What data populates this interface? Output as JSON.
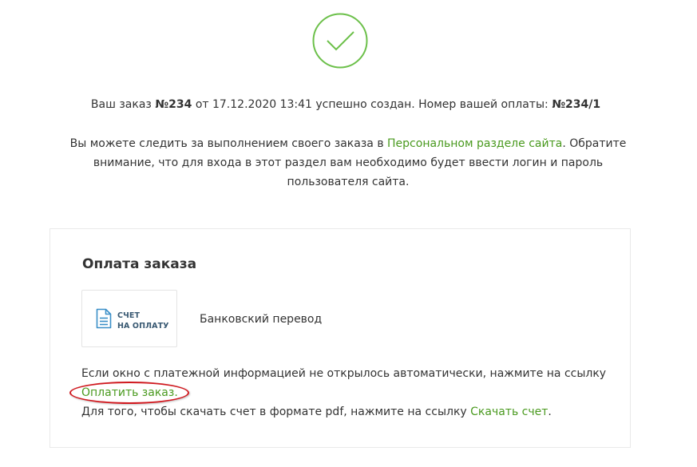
{
  "status": {
    "icon": "checkmark-circle-icon",
    "color": "#6cc04a"
  },
  "order": {
    "prefix": "Ваш заказ ",
    "number": "№234",
    "middle": " от 17.12.2020 13:41 успешно создан. Номер вашей оплаты: ",
    "payment_number": "№234/1"
  },
  "info": {
    "text_before": "Вы можете следить за выполнением своего заказа в ",
    "link_label": "Персональном разделе сайта",
    "text_after": ". Обратите внимание, что для входа в этот раздел вам необходимо будет ввести логин и пароль пользователя сайта."
  },
  "payment": {
    "title": "Оплата заказа",
    "method_card": {
      "icon": "document-icon",
      "line1": "Счет",
      "line2": "на оплату"
    },
    "method_name": "Банковский перевод",
    "note_text": "Если окно с платежной информацией не открылось автоматически, нажмите на ссылку ",
    "pay_link": "Оплатить заказ.",
    "download_text": "Для того, чтобы скачать счет в формате pdf, нажмите на ссылку ",
    "download_link": "Скачать счет",
    "download_end": "."
  },
  "colors": {
    "link": "#4a9a1f",
    "highlight": "#d0181e",
    "card_text": "#3a5a73"
  }
}
